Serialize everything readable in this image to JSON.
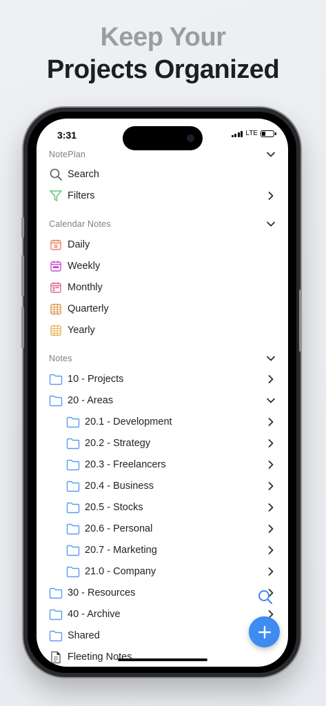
{
  "headline": {
    "line1": "Keep Your",
    "line2": "Projects Organized"
  },
  "status_bar": {
    "time": "3:31",
    "network": "LTE"
  },
  "notepan_section": {
    "title": "NotePlan",
    "items": [
      {
        "label": "Search",
        "icon": "search-icon"
      },
      {
        "label": "Filters",
        "icon": "filter-icon"
      }
    ]
  },
  "calendar_section": {
    "title": "Calendar Notes",
    "items": [
      {
        "label": "Daily",
        "icon": "calendar-daily-icon",
        "color": "#e9825a"
      },
      {
        "label": "Weekly",
        "icon": "calendar-weekly-icon",
        "color": "#c94fd0"
      },
      {
        "label": "Monthly",
        "icon": "calendar-monthly-icon",
        "color": "#e0628f"
      },
      {
        "label": "Quarterly",
        "icon": "calendar-quarterly-icon",
        "color": "#e3954a"
      },
      {
        "label": "Yearly",
        "icon": "calendar-yearly-icon",
        "color": "#e6b454"
      }
    ]
  },
  "notes_section": {
    "title": "Notes",
    "folders": [
      {
        "label": "10 - Projects"
      },
      {
        "label": "20 - Areas"
      },
      {
        "label": "20.1 - Development"
      },
      {
        "label": "20.2 - Strategy"
      },
      {
        "label": "20.3 - Freelancers"
      },
      {
        "label": "20.4 - Business"
      },
      {
        "label": "20.5 - Stocks"
      },
      {
        "label": "20.6 - Personal"
      },
      {
        "label": "20.7 - Marketing"
      },
      {
        "label": "21.0 - Company"
      },
      {
        "label": "30 - Resources"
      },
      {
        "label": "40 - Archive"
      },
      {
        "label": "Shared"
      },
      {
        "label": "Fleeting Notes"
      }
    ]
  },
  "colors": {
    "accent": "#3d8cf0",
    "folder": "#5b9bf2",
    "text": "#1f2023",
    "muted": "#7b7e84"
  }
}
